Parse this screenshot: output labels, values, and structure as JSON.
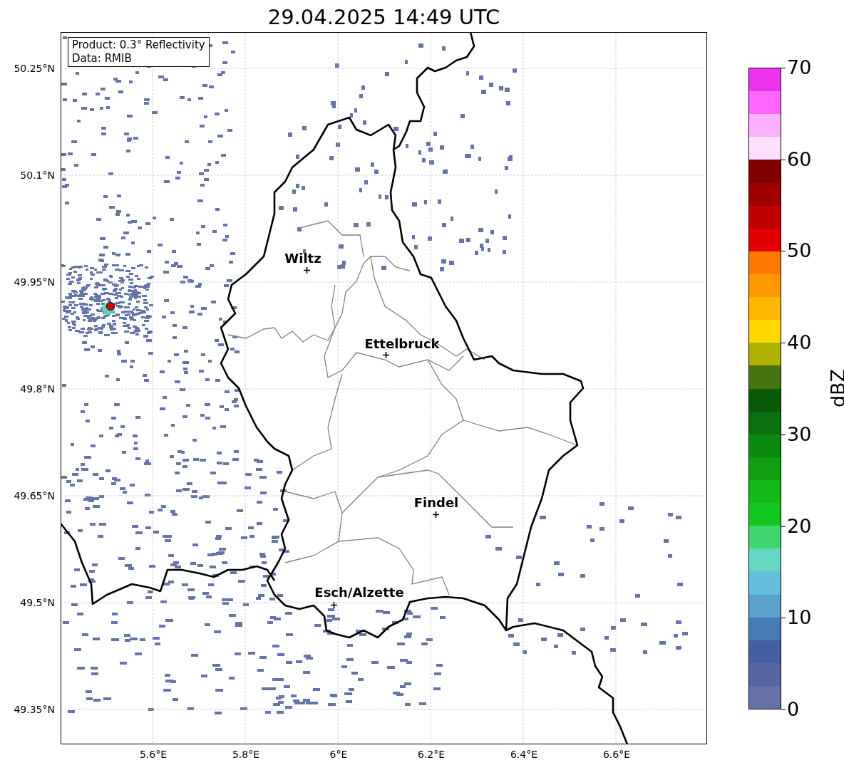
{
  "title": "29.04.2025 14:49 UTC",
  "info_box": {
    "lines": [
      "Product: 0.3° Reflectivity",
      "Data: RMIB"
    ]
  },
  "cities": [
    {
      "name": "Wiltz"
    },
    {
      "name": "Ettelbruck"
    },
    {
      "name": "Findel"
    },
    {
      "name": "Esch/Alzette"
    }
  ],
  "y_ticks": [
    "50.25°N",
    "50.1°N",
    "49.95°N",
    "49.8°N",
    "49.65°N",
    "49.5°N",
    "49.35°N"
  ],
  "x_ticks": [
    "5.6°E",
    "5.8°E",
    "6°E",
    "6.2°E",
    "6.4°E",
    "6.6°E"
  ],
  "colorbar": {
    "label": "dBZ",
    "ticks": [
      "70",
      "60",
      "50",
      "40",
      "30",
      "20",
      "10",
      "0"
    ],
    "bins": [
      {
        "color": "#ee33ee"
      },
      {
        "color": "#ff66ff"
      },
      {
        "color": "#ffb0ff"
      },
      {
        "color": "#ffe0ff"
      },
      {
        "color": "#800000"
      },
      {
        "color": "#a00000"
      },
      {
        "color": "#c00000"
      },
      {
        "color": "#e00000"
      },
      {
        "color": "#ff7800"
      },
      {
        "color": "#ff9800"
      },
      {
        "color": "#ffb800"
      },
      {
        "color": "#ffd800"
      },
      {
        "color": "#b0b000"
      },
      {
        "color": "#457510"
      },
      {
        "color": "#0a5a0a"
      },
      {
        "color": "#0a7010"
      },
      {
        "color": "#0c8a10"
      },
      {
        "color": "#10a010"
      },
      {
        "color": "#10b818"
      },
      {
        "color": "#12c820"
      },
      {
        "color": "#3ed670"
      },
      {
        "color": "#64d8c4"
      },
      {
        "color": "#64c0da"
      },
      {
        "color": "#5aa0c8"
      },
      {
        "color": "#4a7ab4"
      },
      {
        "color": "#4460a0"
      },
      {
        "color": "#5566a0"
      },
      {
        "color": "#6472a6"
      }
    ]
  }
}
